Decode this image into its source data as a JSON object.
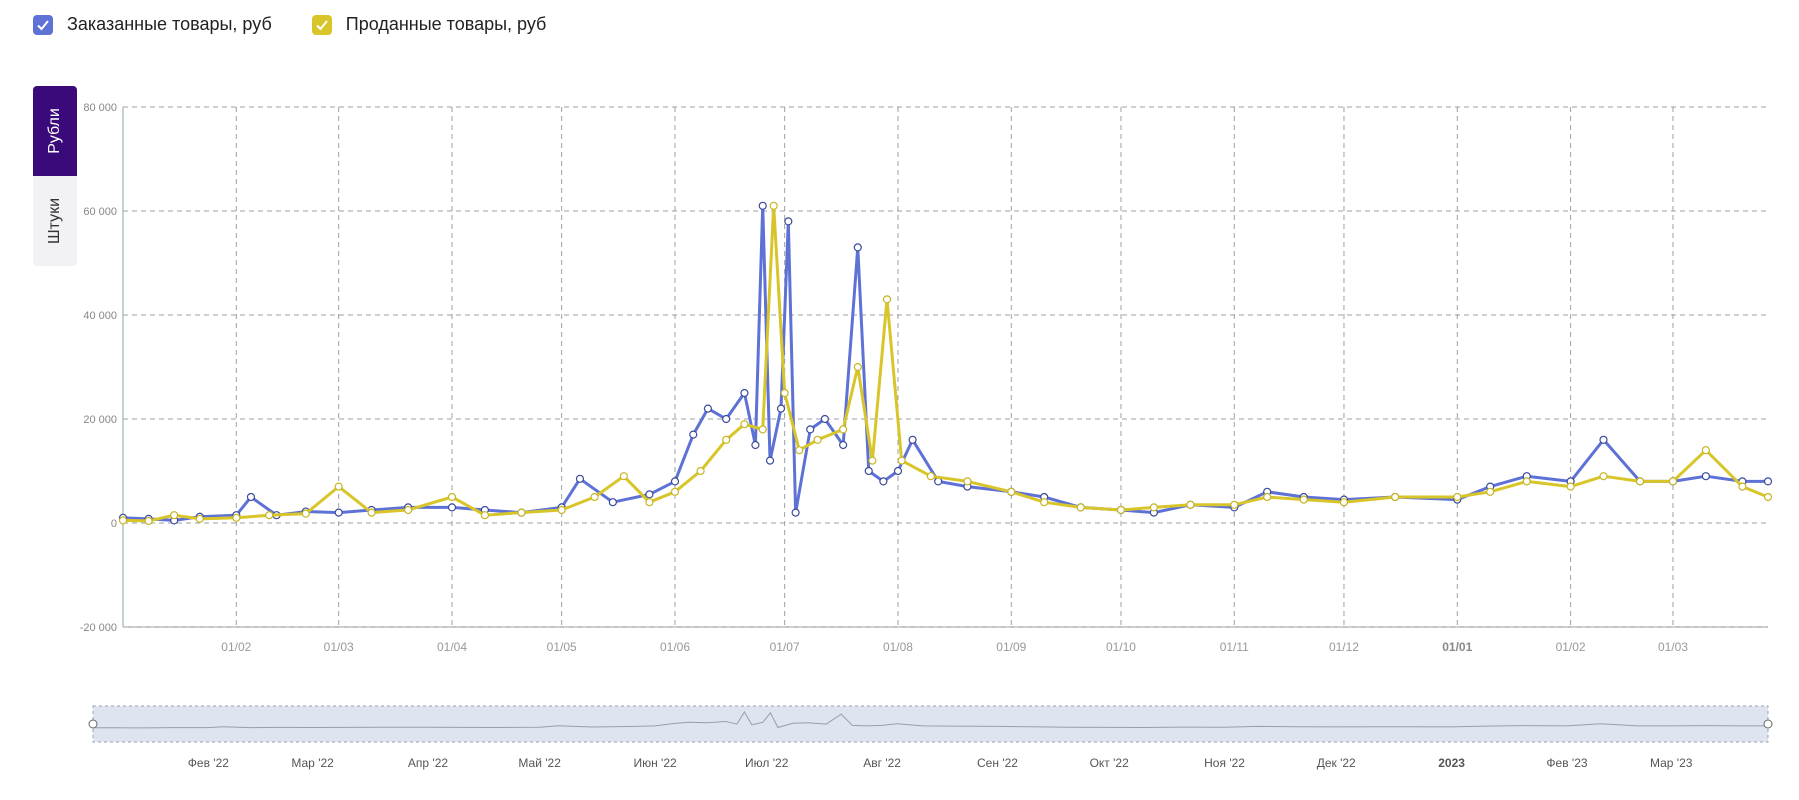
{
  "legend": {
    "ordered": {
      "label": "Заказанные товары, руб",
      "color": "#5e72d6"
    },
    "sold": {
      "label": "Проданные товары, руб",
      "color": "#d8c52a"
    }
  },
  "unit_tabs": [
    {
      "label": "Рубли",
      "active": true
    },
    {
      "label": "Штуки",
      "active": false
    }
  ],
  "navigator": {
    "labels": [
      "Фев '22",
      "Мар '22",
      "Апр '22",
      "Май '22",
      "Июн '22",
      "Июл '22",
      "Авг '22",
      "Сен '22",
      "Окт '22",
      "Ноя '22",
      "Дек '22",
      "2023",
      "Фев '23",
      "Мар '23"
    ],
    "bold": [
      "2023"
    ]
  },
  "chart_data": {
    "type": "line",
    "x_range": [
      "2022-01-01",
      "2023-03-27"
    ],
    "ylim": [
      -20000,
      80000
    ],
    "y_ticks": [
      80000,
      60000,
      40000,
      20000,
      0,
      -20000
    ],
    "y_tick_labels": [
      "80 000",
      "60 000",
      "40 000",
      "20 000",
      "0",
      "-20 000"
    ],
    "x_ticks": [
      {
        "date": "2022-02-01",
        "label": "01/02"
      },
      {
        "date": "2022-03-01",
        "label": "01/03"
      },
      {
        "date": "2022-04-01",
        "label": "01/04"
      },
      {
        "date": "2022-05-01",
        "label": "01/05"
      },
      {
        "date": "2022-06-01",
        "label": "01/06"
      },
      {
        "date": "2022-07-01",
        "label": "01/07"
      },
      {
        "date": "2022-08-01",
        "label": "01/08"
      },
      {
        "date": "2022-09-01",
        "label": "01/09"
      },
      {
        "date": "2022-10-01",
        "label": "01/10"
      },
      {
        "date": "2022-11-01",
        "label": "01/11"
      },
      {
        "date": "2022-12-01",
        "label": "01/12"
      },
      {
        "date": "2023-01-01",
        "label": "01/01",
        "bold": true
      },
      {
        "date": "2023-02-01",
        "label": "01/02"
      },
      {
        "date": "2023-03-01",
        "label": "01/03"
      }
    ],
    "grid": true,
    "series": [
      {
        "name": "Заказанные товары, руб",
        "color": "#5e72d6",
        "points": [
          [
            "2022-01-01",
            1000
          ],
          [
            "2022-01-08",
            800
          ],
          [
            "2022-01-15",
            500
          ],
          [
            "2022-01-22",
            1200
          ],
          [
            "2022-02-01",
            1500
          ],
          [
            "2022-02-05",
            5000
          ],
          [
            "2022-02-12",
            1500
          ],
          [
            "2022-02-20",
            2200
          ],
          [
            "2022-03-01",
            2000
          ],
          [
            "2022-03-10",
            2500
          ],
          [
            "2022-03-20",
            3000
          ],
          [
            "2022-04-01",
            3000
          ],
          [
            "2022-04-10",
            2500
          ],
          [
            "2022-04-20",
            2000
          ],
          [
            "2022-05-01",
            3000
          ],
          [
            "2022-05-06",
            8500
          ],
          [
            "2022-05-15",
            4000
          ],
          [
            "2022-05-25",
            5500
          ],
          [
            "2022-06-01",
            8000
          ],
          [
            "2022-06-06",
            17000
          ],
          [
            "2022-06-10",
            22000
          ],
          [
            "2022-06-15",
            20000
          ],
          [
            "2022-06-20",
            25000
          ],
          [
            "2022-06-23",
            15000
          ],
          [
            "2022-06-25",
            61000
          ],
          [
            "2022-06-27",
            12000
          ],
          [
            "2022-06-30",
            22000
          ],
          [
            "2022-07-02",
            58000
          ],
          [
            "2022-07-04",
            2000
          ],
          [
            "2022-07-08",
            18000
          ],
          [
            "2022-07-12",
            20000
          ],
          [
            "2022-07-17",
            15000
          ],
          [
            "2022-07-21",
            53000
          ],
          [
            "2022-07-24",
            10000
          ],
          [
            "2022-07-28",
            8000
          ],
          [
            "2022-08-01",
            10000
          ],
          [
            "2022-08-05",
            16000
          ],
          [
            "2022-08-12",
            8000
          ],
          [
            "2022-08-20",
            7000
          ],
          [
            "2022-09-01",
            6000
          ],
          [
            "2022-09-10",
            5000
          ],
          [
            "2022-09-20",
            3000
          ],
          [
            "2022-10-01",
            2500
          ],
          [
            "2022-10-10",
            2000
          ],
          [
            "2022-10-20",
            3500
          ],
          [
            "2022-11-01",
            3000
          ],
          [
            "2022-11-10",
            6000
          ],
          [
            "2022-11-20",
            5000
          ],
          [
            "2022-12-01",
            4500
          ],
          [
            "2022-12-15",
            5000
          ],
          [
            "2023-01-01",
            4500
          ],
          [
            "2023-01-10",
            7000
          ],
          [
            "2023-01-20",
            9000
          ],
          [
            "2023-02-01",
            8000
          ],
          [
            "2023-02-10",
            16000
          ],
          [
            "2023-02-20",
            8000
          ],
          [
            "2023-03-01",
            8000
          ],
          [
            "2023-03-10",
            9000
          ],
          [
            "2023-03-20",
            8000
          ],
          [
            "2023-03-27",
            8000
          ]
        ]
      },
      {
        "name": "Проданные товары, руб",
        "color": "#d8c52a",
        "points": [
          [
            "2022-01-01",
            500
          ],
          [
            "2022-01-08",
            400
          ],
          [
            "2022-01-15",
            1500
          ],
          [
            "2022-01-22",
            800
          ],
          [
            "2022-02-01",
            1000
          ],
          [
            "2022-02-10",
            1500
          ],
          [
            "2022-02-20",
            1800
          ],
          [
            "2022-03-01",
            7000
          ],
          [
            "2022-03-10",
            2000
          ],
          [
            "2022-03-20",
            2500
          ],
          [
            "2022-04-01",
            5000
          ],
          [
            "2022-04-10",
            1500
          ],
          [
            "2022-04-20",
            2000
          ],
          [
            "2022-05-01",
            2500
          ],
          [
            "2022-05-10",
            5000
          ],
          [
            "2022-05-18",
            9000
          ],
          [
            "2022-05-25",
            4000
          ],
          [
            "2022-06-01",
            6000
          ],
          [
            "2022-06-08",
            10000
          ],
          [
            "2022-06-15",
            16000
          ],
          [
            "2022-06-20",
            19000
          ],
          [
            "2022-06-25",
            18000
          ],
          [
            "2022-06-28",
            61000
          ],
          [
            "2022-07-01",
            25000
          ],
          [
            "2022-07-05",
            14000
          ],
          [
            "2022-07-10",
            16000
          ],
          [
            "2022-07-17",
            18000
          ],
          [
            "2022-07-21",
            30000
          ],
          [
            "2022-07-25",
            12000
          ],
          [
            "2022-07-29",
            43000
          ],
          [
            "2022-08-02",
            12000
          ],
          [
            "2022-08-10",
            9000
          ],
          [
            "2022-08-20",
            8000
          ],
          [
            "2022-09-01",
            6000
          ],
          [
            "2022-09-10",
            4000
          ],
          [
            "2022-09-20",
            3000
          ],
          [
            "2022-10-01",
            2500
          ],
          [
            "2022-10-10",
            3000
          ],
          [
            "2022-10-20",
            3500
          ],
          [
            "2022-11-01",
            3500
          ],
          [
            "2022-11-10",
            5000
          ],
          [
            "2022-11-20",
            4500
          ],
          [
            "2022-12-01",
            4000
          ],
          [
            "2022-12-15",
            5000
          ],
          [
            "2023-01-01",
            5000
          ],
          [
            "2023-01-10",
            6000
          ],
          [
            "2023-01-20",
            8000
          ],
          [
            "2023-02-01",
            7000
          ],
          [
            "2023-02-10",
            9000
          ],
          [
            "2023-02-20",
            8000
          ],
          [
            "2023-03-01",
            8000
          ],
          [
            "2023-03-10",
            14000
          ],
          [
            "2023-03-20",
            7000
          ],
          [
            "2023-03-27",
            5000
          ]
        ]
      }
    ]
  }
}
